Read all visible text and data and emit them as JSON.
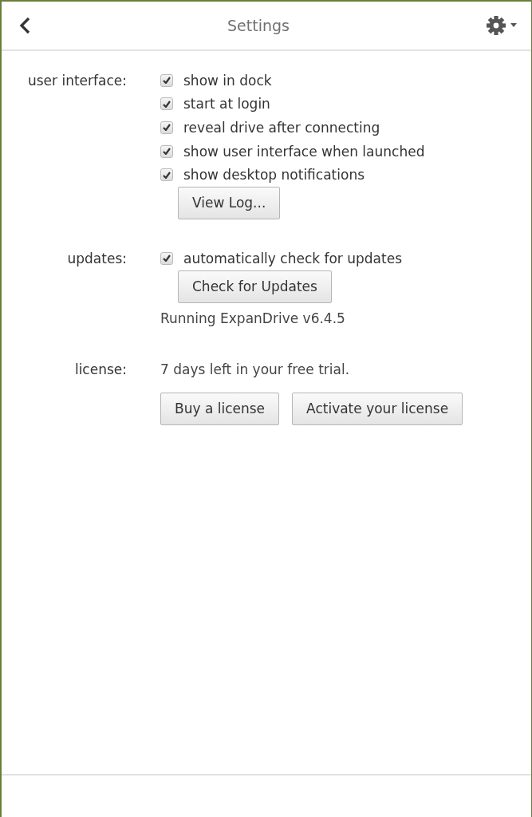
{
  "header": {
    "title": "Settings"
  },
  "sections": [
    {
      "label": "user interface:",
      "items": [
        {
          "kind": "checkbox",
          "label": "show in dock",
          "checked": true
        },
        {
          "kind": "checkbox",
          "label": "start at login",
          "checked": true
        },
        {
          "kind": "checkbox",
          "label": "reveal drive after connecting",
          "checked": true
        },
        {
          "kind": "checkbox",
          "label": "show user interface when launched",
          "checked": true
        },
        {
          "kind": "checkbox",
          "label": "show desktop notifications",
          "checked": true
        },
        {
          "kind": "buttons",
          "labels": [
            "View Log..."
          ]
        }
      ]
    },
    {
      "label": "updates:",
      "items": [
        {
          "kind": "checkbox",
          "label": "automatically check for updates",
          "checked": true
        },
        {
          "kind": "buttons",
          "labels": [
            "Check for Updates"
          ]
        },
        {
          "kind": "text",
          "text": "Running ExpanDrive v6.4.5"
        }
      ]
    },
    {
      "label": "license:",
      "items": [
        {
          "kind": "text",
          "text": "7 days left in your free trial."
        },
        {
          "kind": "buttons",
          "labels": [
            "Buy a license",
            "Activate your license"
          ]
        }
      ]
    }
  ]
}
